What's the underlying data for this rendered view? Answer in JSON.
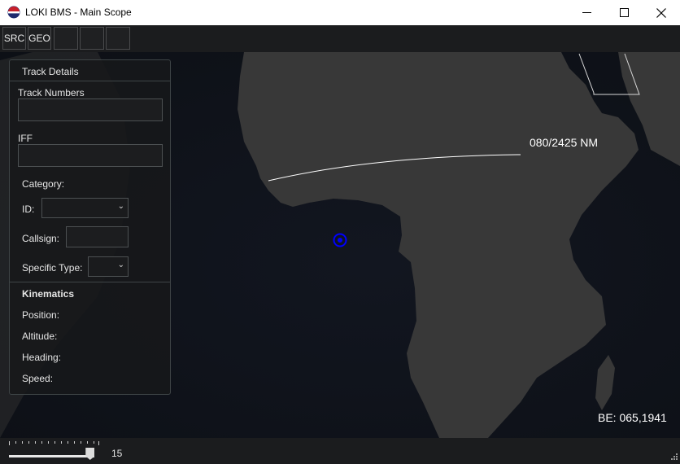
{
  "window": {
    "title": "LOKI BMS - Main Scope",
    "minimize_icon": "minimize-icon",
    "maximize_icon": "maximize-icon",
    "close_icon": "close-icon"
  },
  "toolbar": {
    "buttons": [
      {
        "label": "SRC"
      },
      {
        "label": "GEO"
      },
      {
        "label": ""
      },
      {
        "label": ""
      },
      {
        "label": ""
      }
    ]
  },
  "track_details": {
    "title": "Track Details",
    "track_numbers_label": "Track Numbers",
    "track_numbers_value": "",
    "iff_label": "IFF",
    "iff_value": "",
    "category_label": "Category:",
    "id_label": "ID:",
    "id_value": "",
    "callsign_label": "Callsign:",
    "callsign_value": "",
    "specific_type_label": "Specific Type:",
    "specific_type_value": "",
    "kinematics_title": "Kinematics",
    "position_label": "Position:",
    "altitude_label": "Altitude:",
    "heading_label": "Heading:",
    "speed_label": "Speed:"
  },
  "map": {
    "range_bearing": "080/2425 NM",
    "bullseye": "BE: 065,1941",
    "colors": {
      "ocean": "#0f1218",
      "land": "#3a3a3a",
      "track": "#0000ff",
      "measure_line": "#ffffff"
    }
  },
  "zoom": {
    "value": "15",
    "fraction": 0.95
  }
}
